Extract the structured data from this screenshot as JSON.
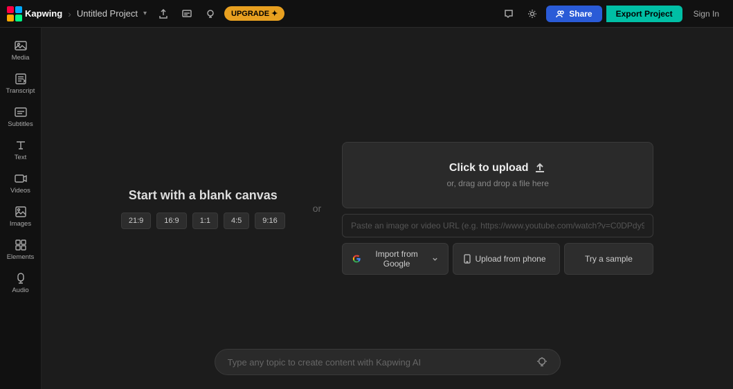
{
  "topnav": {
    "brand": "Kapwing",
    "separator": "›",
    "project_name": "Untitled Project",
    "chevron": "▾",
    "upgrade_label": "UPGRADE ✦",
    "share_label": "Share",
    "export_label": "Export Project",
    "signin_label": "Sign In"
  },
  "sidebar": {
    "items": [
      {
        "label": "Media",
        "icon": "🖼"
      },
      {
        "label": "Transcript",
        "icon": "📝"
      },
      {
        "label": "Subtitles",
        "icon": "💬"
      },
      {
        "label": "Text",
        "icon": "T"
      },
      {
        "label": "Videos",
        "icon": "▶"
      },
      {
        "label": "Images",
        "icon": "🖼"
      },
      {
        "label": "Elements",
        "icon": "◈"
      },
      {
        "label": "Audio",
        "icon": "♪"
      }
    ]
  },
  "blank_canvas": {
    "title": "Start with a blank canvas",
    "ratios": [
      "21:9",
      "16:9",
      "1:1",
      "4:5",
      "9:16"
    ],
    "or_label": "or"
  },
  "upload": {
    "click_label": "Click to upload",
    "drag_label": "or, drag and drop a file here",
    "url_placeholder": "Paste an image or video URL (e.g. https://www.youtube.com/watch?v=C0DPdy9",
    "import_google_label": "Import from Google",
    "upload_phone_label": "Upload from phone",
    "try_sample_label": "Try a sample"
  },
  "ai_bar": {
    "placeholder": "Type any topic to create content with Kapwing AI"
  }
}
